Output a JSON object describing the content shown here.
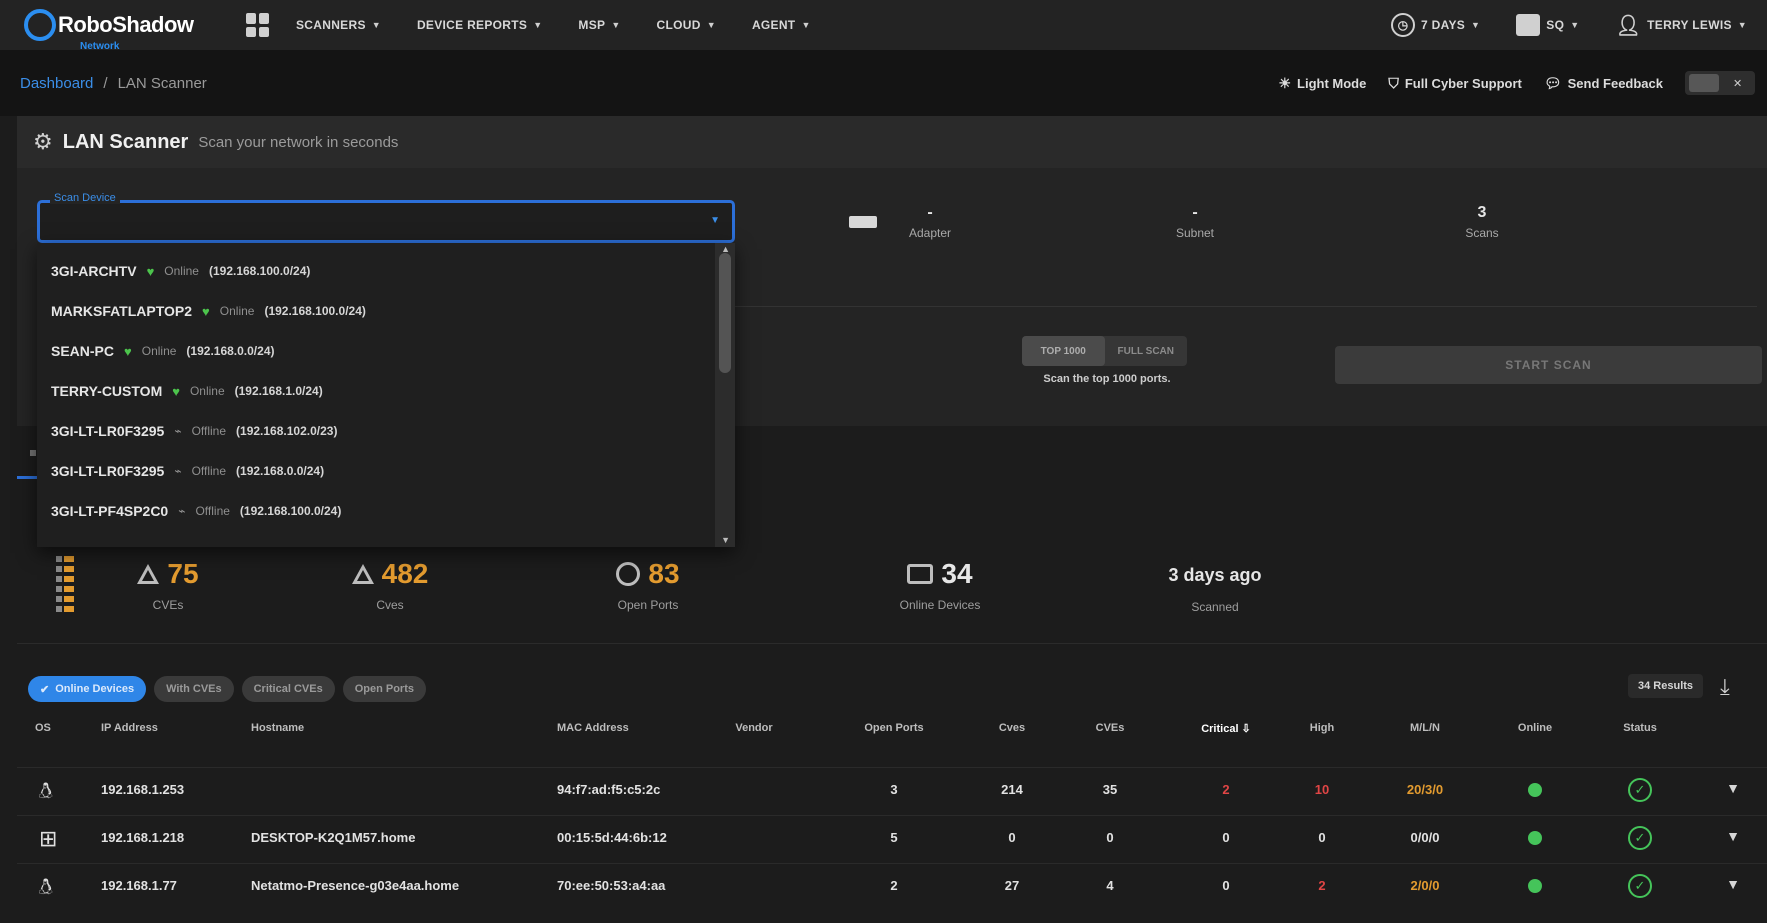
{
  "nav": {
    "logo_text": "RoboShadow",
    "logo_sub": "Network",
    "menu": [
      {
        "label": "SCANNERS"
      },
      {
        "label": "DEVICE REPORTS"
      },
      {
        "label": "MSP"
      },
      {
        "label": "CLOUD"
      },
      {
        "label": "AGENT"
      }
    ],
    "right": {
      "days": "7 DAYS",
      "org": "SQ",
      "user": "TERRY LEWIS"
    }
  },
  "breadcrumb": {
    "root": "Dashboard",
    "sep": "/",
    "current": "LAN Scanner"
  },
  "actions": {
    "light_mode": "Light Mode",
    "cyber_support": "Full Cyber Support",
    "feedback": "Send Feedback",
    "toggle_x": "✕"
  },
  "panel": {
    "title": "LAN Scanner",
    "subtitle": "Scan your network in seconds",
    "field_label": "Scan Device",
    "stats": [
      {
        "value": "-",
        "label": "Adapter"
      },
      {
        "value": "-",
        "label": "Subnet"
      },
      {
        "value": "3",
        "label": "Scans"
      }
    ],
    "modes": [
      "TOP 1000",
      "FULL SCAN"
    ],
    "mode_help": "Scan the top 1000 ports.",
    "start_label": "START SCAN"
  },
  "dropdown": [
    {
      "name": "3GI-ARCHTV",
      "online": true,
      "status": "Online",
      "ip": "(192.168.100.0/24)"
    },
    {
      "name": "MARKSFATLAPTOP2",
      "online": true,
      "status": "Online",
      "ip": "(192.168.100.0/24)"
    },
    {
      "name": "SEAN-PC",
      "online": true,
      "status": "Online",
      "ip": "(192.168.0.0/24)"
    },
    {
      "name": "TERRY-CUSTOM",
      "online": true,
      "status": "Online",
      "ip": "(192.168.1.0/24)"
    },
    {
      "name": "3GI-LT-LR0F3295",
      "online": false,
      "status": "Offline",
      "ip": "(192.168.102.0/23)"
    },
    {
      "name": "3GI-LT-LR0F3295",
      "online": false,
      "status": "Offline",
      "ip": "(192.168.0.0/24)"
    },
    {
      "name": "3GI-LT-PF4SP2C0",
      "online": false,
      "status": "Offline",
      "ip": "(192.168.100.0/24)"
    }
  ],
  "kpis": [
    {
      "value": "75",
      "label": "CVEs",
      "color": "#e39b2f",
      "icon": "warning-icon"
    },
    {
      "value": "482",
      "label": "Cves",
      "color": "#e39b2f",
      "icon": "warning-icon"
    },
    {
      "value": "83",
      "label": "Open Ports",
      "color": "#e39b2f",
      "icon": "clock-icon"
    },
    {
      "value": "34",
      "label": "Online Devices",
      "color": "#e6e6e6",
      "icon": "monitor-icon"
    },
    {
      "value": "3 days ago",
      "label": "Scanned",
      "color": "#e6e6e6",
      "icon": ""
    }
  ],
  "filters": [
    {
      "label": "Online Devices",
      "active": true
    },
    {
      "label": "With CVEs",
      "active": false
    },
    {
      "label": "Critical CVEs",
      "active": false
    },
    {
      "label": "Open Ports",
      "active": false
    }
  ],
  "results": "34 Results",
  "table": {
    "columns": [
      "OS",
      "IP Address",
      "Hostname",
      "MAC Address",
      "Vendor",
      "Open Ports",
      "Cves",
      "CVEs",
      "Critical ⇩",
      "High",
      "M/L/N",
      "Online",
      "Status"
    ],
    "rows": [
      {
        "os": "linux",
        "ip": "192.168.1.253",
        "host": "",
        "mac": "94:f7:ad:f5:c5:2c",
        "vendor": "",
        "ports": "3",
        "cves": "214",
        "cves2": "35",
        "critical": "2",
        "high": "10",
        "mln": "20/3/0"
      },
      {
        "os": "windows",
        "ip": "192.168.1.218",
        "host": "DESKTOP-K2Q1M57.home",
        "mac": "00:15:5d:44:6b:12",
        "vendor": "",
        "ports": "5",
        "cves": "0",
        "cves2": "0",
        "critical": "0",
        "high": "0",
        "mln": "0/0/0"
      },
      {
        "os": "linux",
        "ip": "192.168.1.77",
        "host": "Netatmo-Presence-g03e4aa.home",
        "mac": "70:ee:50:53:a4:aa",
        "vendor": "",
        "ports": "2",
        "cves": "27",
        "cves2": "4",
        "critical": "0",
        "high": "2",
        "mln": "2/0/0"
      }
    ],
    "colors": {
      "critical": "#e04545",
      "high": "#e04545",
      "mln": "#e39b2f",
      "online": "#45c45a"
    }
  }
}
